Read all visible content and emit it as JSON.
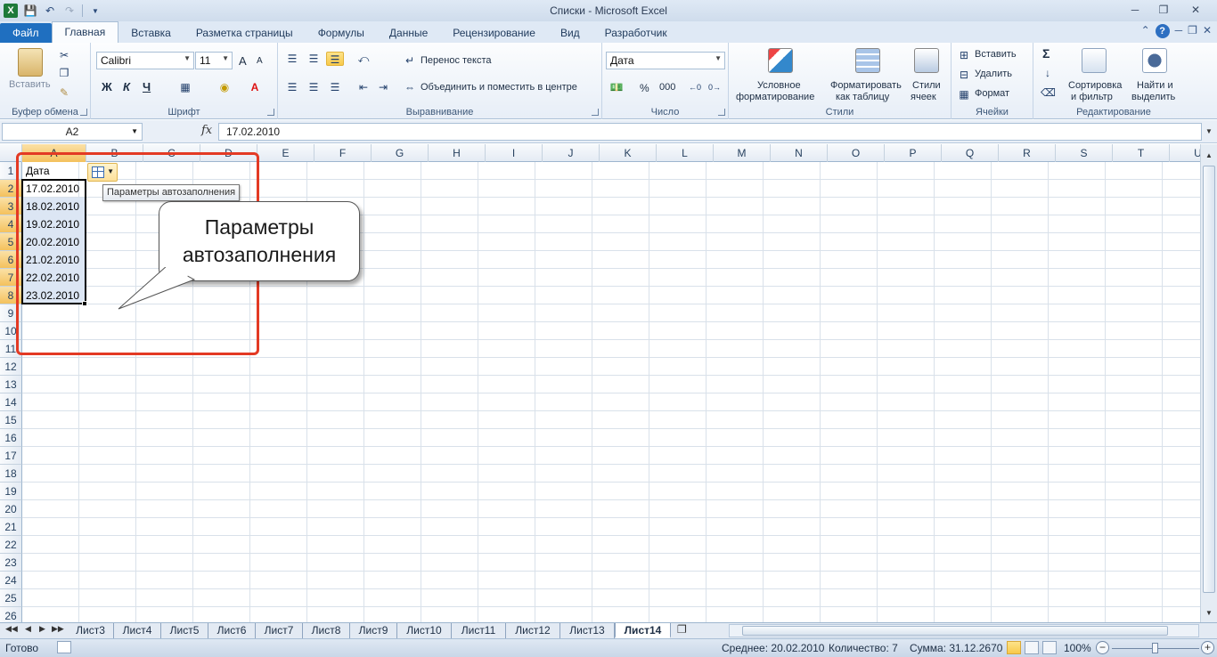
{
  "window": {
    "title": "Списки  -  Microsoft Excel"
  },
  "qat": {
    "app_icon": "X"
  },
  "ribbon_tabs": [
    "Файл",
    "Главная",
    "Вставка",
    "Разметка страницы",
    "Формулы",
    "Данные",
    "Рецензирование",
    "Вид",
    "Разработчик"
  ],
  "ribbon": {
    "clipboard": {
      "label": "Буфер обмена",
      "paste": "Вставить"
    },
    "font": {
      "label": "Шрифт",
      "name": "Calibri",
      "size": "11",
      "bold": "Ж",
      "italic": "К",
      "underline": "Ч",
      "grow": "A",
      "shrink": "A"
    },
    "alignment": {
      "label": "Выравнивание",
      "wrap": "Перенос текста",
      "merge": "Объединить и поместить в центре"
    },
    "number": {
      "label": "Число",
      "format": "Дата",
      "percent": "%",
      "thousands": "000"
    },
    "styles": {
      "label": "Стили",
      "conditional_line1": "Условное",
      "conditional_line2": "форматирование",
      "format_table_line1": "Форматировать",
      "format_table_line2": "как таблицу",
      "cell_styles_line1": "Стили",
      "cell_styles_line2": "ячеек"
    },
    "cells": {
      "label": "Ячейки",
      "insert": "Вставить",
      "delete": "Удалить",
      "format": "Формат"
    },
    "editing": {
      "label": "Редактирование",
      "sum": "Σ",
      "sort_line1": "Сортировка",
      "sort_line2": "и фильтр",
      "find_line1": "Найти и",
      "find_line2": "выделить"
    }
  },
  "formula_bar": {
    "name_box": "A2",
    "fx": "fx",
    "value": "17.02.2010"
  },
  "columns": [
    "A",
    "B",
    "C",
    "D",
    "E",
    "F",
    "G",
    "H",
    "I",
    "J",
    "K",
    "L",
    "M",
    "N",
    "O",
    "P",
    "Q",
    "R",
    "S",
    "T",
    "U"
  ],
  "rows": [
    "1",
    "2",
    "3",
    "4",
    "5",
    "6",
    "7",
    "8",
    "9",
    "10",
    "11",
    "12",
    "13",
    "14",
    "15",
    "16",
    "17",
    "18",
    "19",
    "20",
    "21",
    "22",
    "23",
    "24",
    "25",
    "26"
  ],
  "cells": {
    "A1": "Дата",
    "A_values": [
      "17.02.2010",
      "18.02.2010",
      "19.02.2010",
      "20.02.2010",
      "21.02.2010",
      "22.02.2010",
      "23.02.2010"
    ]
  },
  "autofill": {
    "tooltip": "Параметры автозаполнения"
  },
  "callout": {
    "line1": "Параметры",
    "line2": "автозаполнения"
  },
  "sheets": [
    "Лист3",
    "Лист4",
    "Лист5",
    "Лист6",
    "Лист7",
    "Лист8",
    "Лист9",
    "Лист10",
    "Лист11",
    "Лист12",
    "Лист13",
    "Лист14"
  ],
  "active_sheet": "Лист14",
  "status": {
    "ready": "Готово",
    "average": "Среднее: 20.02.2010",
    "count": "Количество: 7",
    "sum": "Сумма: 31.12.2670",
    "zoom": "100%"
  }
}
